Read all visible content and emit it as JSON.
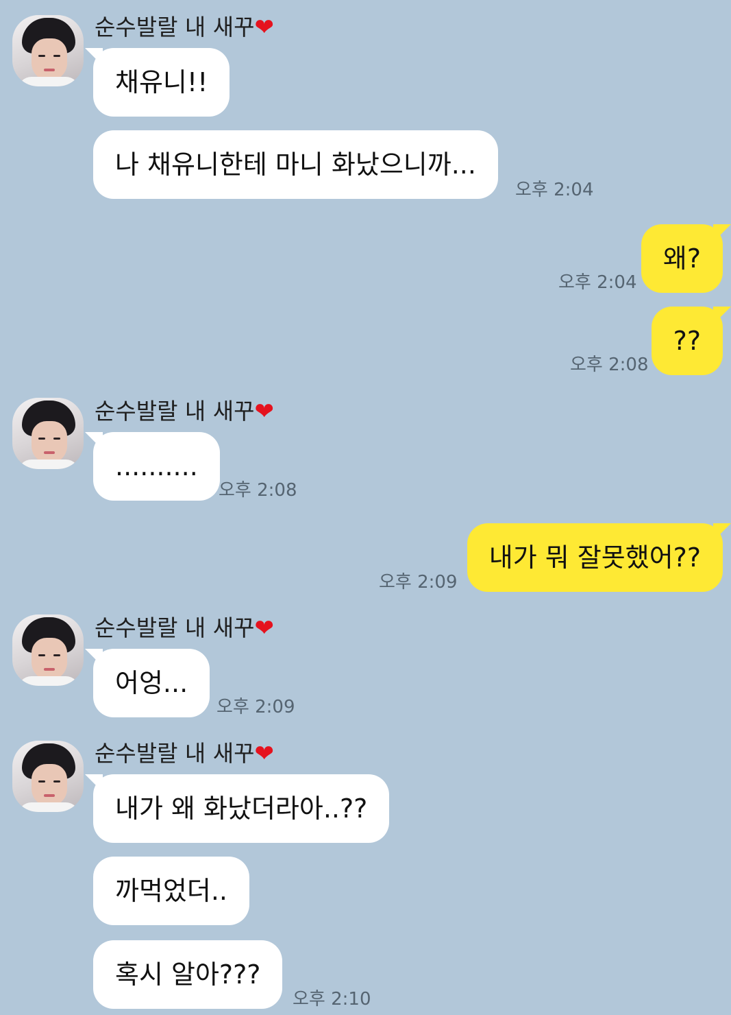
{
  "sender_name": "순수발랄 내 새꾸",
  "heart": "❤",
  "messages": [
    {
      "text": "채유니!!"
    },
    {
      "text": "나 채유니한테 마니 화났으니까...",
      "time": "오후 2:04"
    },
    {
      "text": "왜?",
      "time": "오후 2:04"
    },
    {
      "text": "??",
      "time": "오후 2:08"
    },
    {
      "text": "..........",
      "time": "오후 2:08"
    },
    {
      "text": "내가 뭐 잘못했어??",
      "time": "오후 2:09"
    },
    {
      "text": "어엉...",
      "time": "오후 2:09"
    },
    {
      "text": "내가 왜 화났더라아..??"
    },
    {
      "text": "까먹었더.."
    },
    {
      "text": "혹시 알아???",
      "time": "오후 2:10"
    }
  ]
}
